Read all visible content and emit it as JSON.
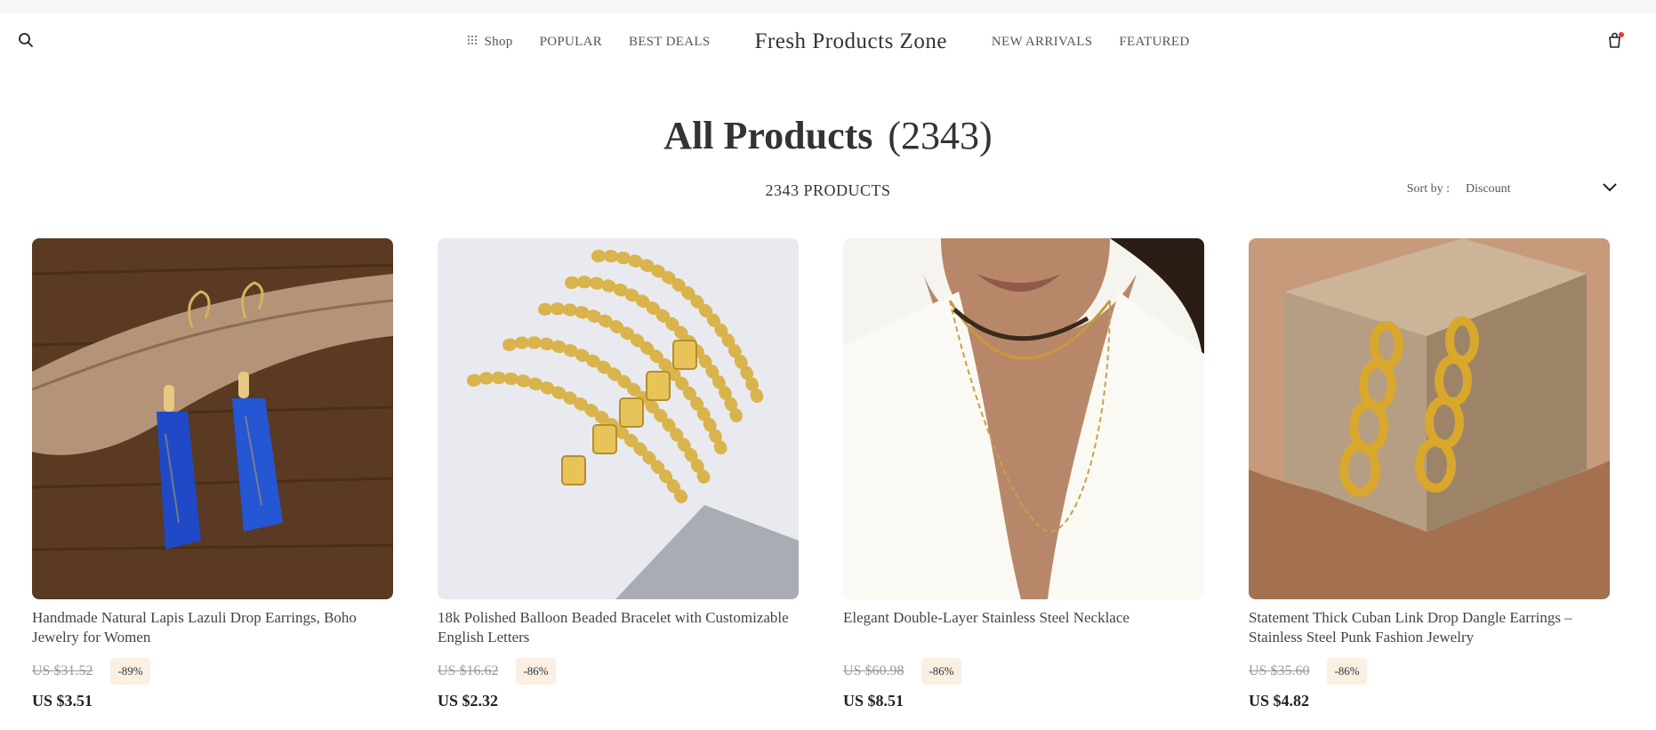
{
  "header": {
    "brand": "Fresh Products Zone",
    "shop_label": "Shop",
    "nav_left": [
      "POPULAR",
      "BEST DEALS"
    ],
    "nav_right": [
      "NEW ARRIVALS",
      "FEATURED"
    ],
    "icons": [
      "search-icon",
      "grid-icon",
      "cart-icon"
    ],
    "cart_dot_color": "#e33b3b"
  },
  "main": {
    "title": "All Products",
    "title_count": "(2343)",
    "product_count": "2343 PRODUCTS",
    "sort_label": "Sort by :",
    "sort_value": "Discount"
  },
  "products": [
    {
      "name": "Handmade Natural Lapis Lazuli Drop Earrings, Boho Jewelry for Women",
      "old_price": "US $31.52",
      "discount": "-89%",
      "price": "US $3.51"
    },
    {
      "name": "18k Polished Balloon Beaded Bracelet with Customizable English Letters",
      "old_price": "US $16.62",
      "discount": "-86%",
      "price": "US $2.32"
    },
    {
      "name": "Elegant Double-Layer Stainless Steel Necklace",
      "old_price": "US $60.98",
      "discount": "-86%",
      "price": "US $8.51"
    },
    {
      "name": "Statement Thick Cuban Link Drop Dangle Earrings – Stainless Steel Punk Fashion Jewelry",
      "old_price": "US $35.60",
      "discount": "-86%",
      "price": "US $4.82"
    }
  ]
}
